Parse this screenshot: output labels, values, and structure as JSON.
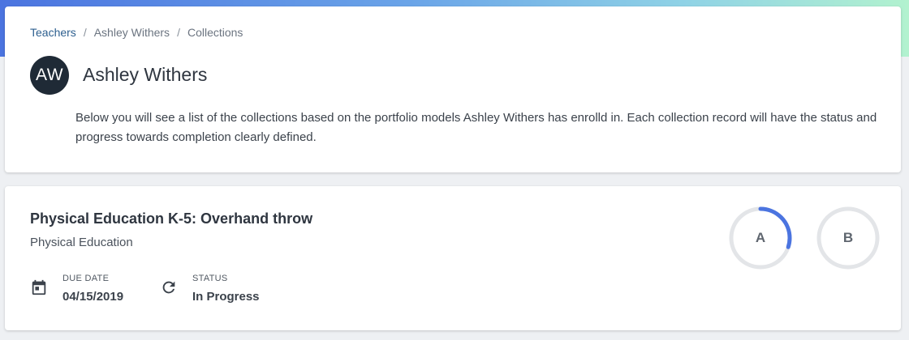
{
  "breadcrumb": {
    "items": [
      "Teachers",
      "Ashley Withers",
      "Collections"
    ],
    "separator": "/"
  },
  "teacher": {
    "initials": "AW",
    "name": "Ashley Withers",
    "description": "Below you will see a list of the collections based on the portfolio models Ashley Withers has enrolld in. Each collection record will have the status and progress towards completion clearly defined."
  },
  "collection": {
    "title": "Physical Education K-5: Overhand throw",
    "subject": "Physical Education",
    "due_date_label": "DUE DATE",
    "due_date": "04/15/2019",
    "status_label": "STATUS",
    "status": "In Progress",
    "icons": {
      "due": "calendar-icon",
      "status": "refresh-icon"
    },
    "progress": [
      {
        "label": "A",
        "fraction": 0.3
      },
      {
        "label": "B",
        "fraction": 0
      }
    ]
  },
  "colors": {
    "accent": "#4b74e0",
    "ring_track": "#e3e5e8",
    "avatar_bg": "#1f2a36",
    "link": "#2d5f8f"
  }
}
